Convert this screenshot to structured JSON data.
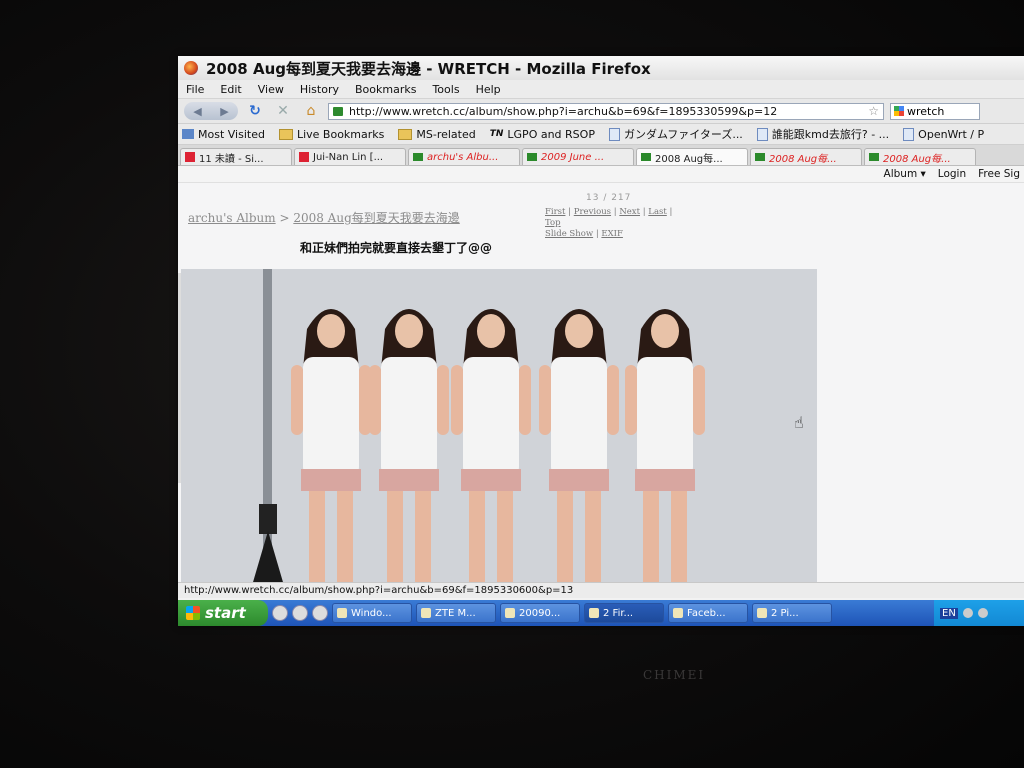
{
  "window": {
    "title": "2008 Aug每到夏天我要去海邊 - WRETCH - Mozilla Firefox"
  },
  "menu": [
    "File",
    "Edit",
    "View",
    "History",
    "Bookmarks",
    "Tools",
    "Help"
  ],
  "nav": {
    "url": "http://www.wretch.cc/album/show.php?i=archu&b=69&f=1895330599&p=12",
    "search_value": "wretch"
  },
  "bookmarks": [
    "Most Visited",
    "Live Bookmarks",
    "MS-related",
    "LGPO and RSOP",
    "ガンダムファイターズ...",
    "誰能跟kmd去旅行? - ...",
    "OpenWrt / P"
  ],
  "tabs": [
    {
      "label": "11 未讀 - Si..."
    },
    {
      "label": "Jui-Nan Lin [..."
    },
    {
      "label": "archu's Albu..."
    },
    {
      "label": "2009 June ..."
    },
    {
      "label": "2008 Aug每..."
    },
    {
      "label": "2008 Aug每..."
    },
    {
      "label": "2008 Aug每..."
    }
  ],
  "site_nav": {
    "album": "Album ▾",
    "login": "Login",
    "free": "Free Sig"
  },
  "page": {
    "breadcrumb_album": "archu's Album",
    "breadcrumb_sep": " > ",
    "breadcrumb_title": "2008 Aug每到夏天我要去海邊",
    "counter": "13 / 217",
    "pager": {
      "first": "First",
      "previous": "Previous",
      "next": "Next",
      "last": "Last",
      "top": "Top",
      "slideshow": "Slide Show",
      "exif": "EXIF"
    },
    "caption": "和正妹們拍完就要直接去墾丁了@@"
  },
  "status": {
    "text": "http://www.wretch.cc/album/show.php?i=archu&b=69&f=1895330600&p=13"
  },
  "taskbar": {
    "start": "start",
    "tasks": [
      "Windo...",
      "ZTE M...",
      "20090...",
      "2 Fir...",
      "Faceb...",
      "2 Pi..."
    ],
    "tray_lang": "EN"
  },
  "monitor": {
    "brand": "CHIMEI"
  }
}
